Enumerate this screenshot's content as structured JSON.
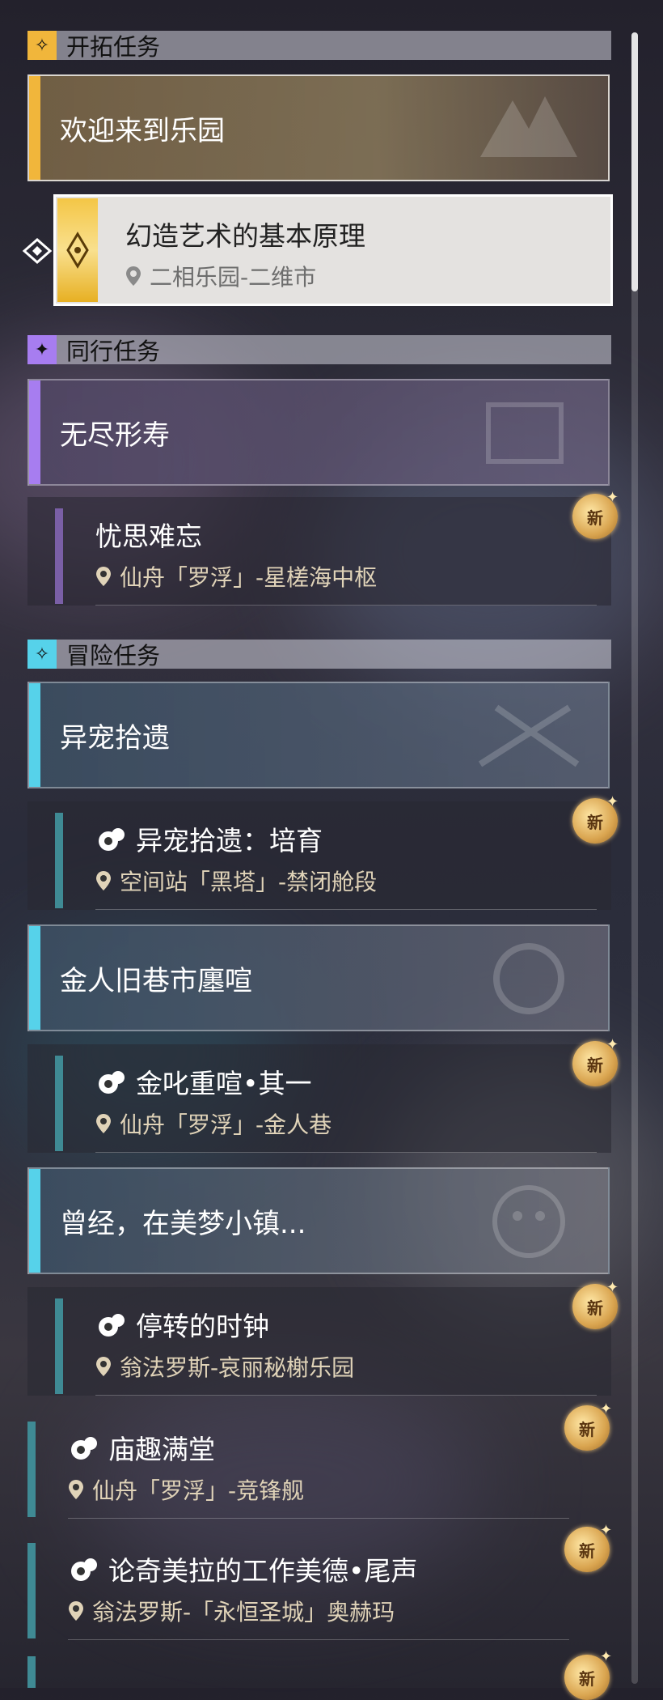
{
  "colors": {
    "trailblaze": "#f1b63b",
    "companion": "#a77df0",
    "adventure": "#56d2ea",
    "new_badge": "#d9a44f"
  },
  "sections": {
    "trailblaze": {
      "label": "开拓任务",
      "icon": "trailblaze-icon"
    },
    "companion": {
      "label": "同行任务",
      "icon": "star-icon"
    },
    "adventure": {
      "label": "冒险任务",
      "icon": "compass-star-icon"
    }
  },
  "trailblaze": {
    "group_title": "欢迎来到乐园",
    "active_quest": {
      "title": "幻造艺术的基本原理",
      "location": "二相乐园-二维市"
    }
  },
  "companion": {
    "group_title": "无尽形寿",
    "quest": {
      "title": "忧思难忘",
      "location": "仙舟「罗浮」-星槎海中枢",
      "badge": "新"
    }
  },
  "adventure": {
    "groups": [
      {
        "title": "异宠拾遗",
        "quests": [
          {
            "title": "异宠拾遗：培育",
            "location": "空间站「黑塔」-禁闭舱段",
            "badge": "新"
          }
        ]
      },
      {
        "title": "金人旧巷市廛喧",
        "quests": [
          {
            "title": "金叱重喧•其一",
            "location": "仙舟「罗浮」-金人巷",
            "badge": "新"
          }
        ]
      },
      {
        "title": "曾经，在美梦小镇...",
        "quests": [
          {
            "title": "停转的时钟",
            "location": "翁法罗斯-哀丽秘榭乐园",
            "badge": "新"
          }
        ]
      }
    ],
    "loose_quests": [
      {
        "title": "庙趣满堂",
        "location": "仙舟「罗浮」-竞锋舰",
        "badge": "新"
      },
      {
        "title": "论奇美拉的工作美德•尾声",
        "location": "翁法罗斯-「永恒圣城」奥赫玛",
        "badge": "新"
      }
    ],
    "bottom_badge": "新"
  }
}
